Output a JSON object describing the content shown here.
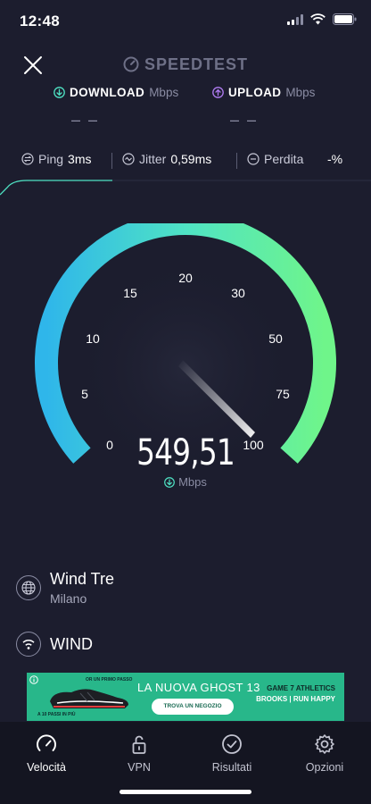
{
  "status_bar": {
    "time": "12:48"
  },
  "header": {
    "brand": "SPEEDTEST"
  },
  "download": {
    "label": "DOWNLOAD",
    "unit": "Mbps",
    "value": "– –"
  },
  "upload": {
    "label": "UPLOAD",
    "unit": "Mbps",
    "value": "– –"
  },
  "stats": {
    "ping_label": "Ping",
    "ping_value": "3ms",
    "jitter_label": "Jitter",
    "jitter_value": "0,59ms",
    "loss_label": "Perdita",
    "loss_value": "-%"
  },
  "gauge": {
    "labels": [
      "0",
      "5",
      "10",
      "15",
      "20",
      "30",
      "50",
      "75",
      "100"
    ],
    "reading": "549,51",
    "unit": "Mbps",
    "colors": {
      "start": "#2fb6ea",
      "mid": "#4fe3c4",
      "end": "#6ff58a"
    }
  },
  "provider": {
    "name": "Wind Tre",
    "city": "Milano",
    "network": "WIND"
  },
  "ad": {
    "headline": "LA NUOVA GHOST 13",
    "cta": "TROVA UN NEGOZIO",
    "brand_top": "GAME 7 ATHLETICS",
    "brand_bottom": "BROOKS | RUN HAPPY",
    "small_top": "OR UN PRIMO PASSO",
    "small_bottom": "A 10 PASSI IN PIÙ"
  },
  "tabs": [
    {
      "label": "Velocità",
      "icon": "speedometer-icon"
    },
    {
      "label": "VPN",
      "icon": "lock-icon"
    },
    {
      "label": "Risultati",
      "icon": "check-circle-icon"
    },
    {
      "label": "Opzioni",
      "icon": "gear-icon"
    }
  ]
}
